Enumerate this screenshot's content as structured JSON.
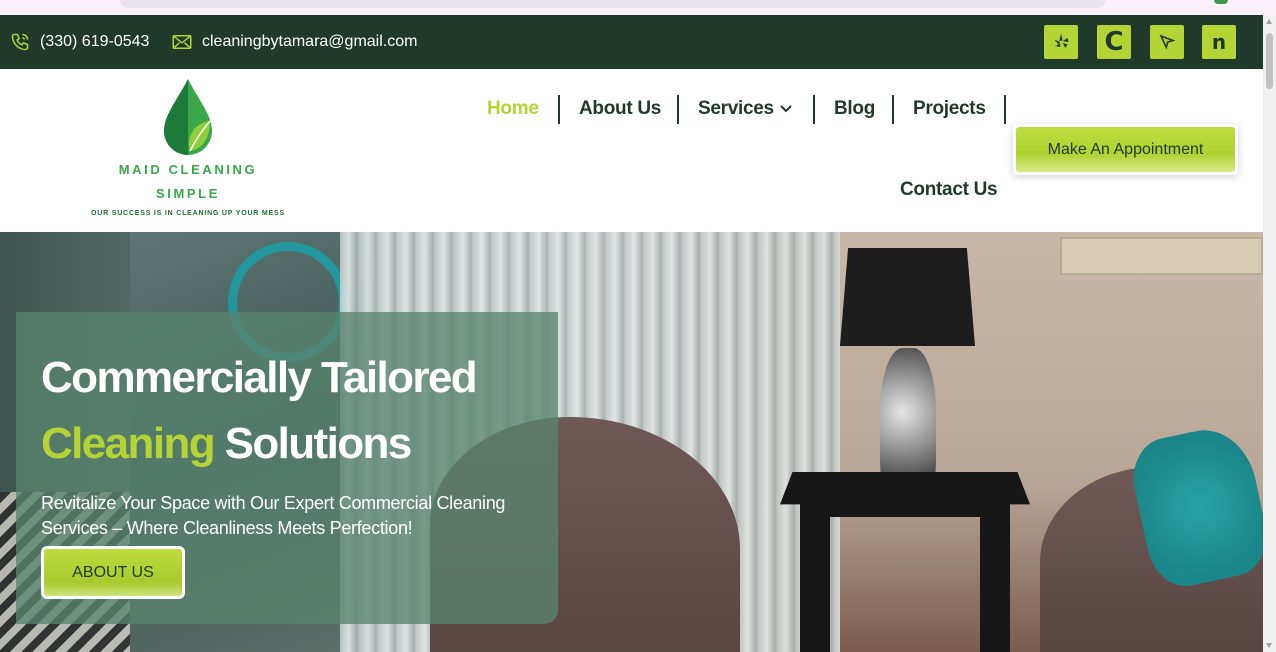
{
  "topbar": {
    "phone": "(330) 619-0543",
    "email": "cleaningbytamara@gmail.com",
    "social": [
      {
        "icon": "yelp-icon",
        "glyph": "✱"
      },
      {
        "icon": "c-brand-icon",
        "glyph": "C"
      },
      {
        "icon": "cursor-arrow-icon",
        "glyph": "➤"
      },
      {
        "icon": "n-brand-icon",
        "glyph": "n"
      }
    ]
  },
  "logo": {
    "line1": "MAID CLEANING",
    "line2": "SIMPLE",
    "tagline": "OUR SUCCESS IS IN CLEANING UP YOUR MESS"
  },
  "nav": {
    "items": [
      "Home",
      "About Us",
      "Services",
      "Blog",
      "Projects",
      "Contact Us"
    ],
    "active": "Home",
    "cta": "Make An Appointment"
  },
  "hero": {
    "title_line1": "Commercially Tailored",
    "title_highlight": "Cleaning",
    "title_rest": "Solutions",
    "subtitle": "Revitalize Your Space with Our Expert Commercial Cleaning Services – Where Cleanliness Meets Perfection!",
    "button": "ABOUT US"
  },
  "colors": {
    "brand_dark": "#1f3a2b",
    "accent_lime": "#b4d335",
    "logo_green": "#3aa74a"
  }
}
